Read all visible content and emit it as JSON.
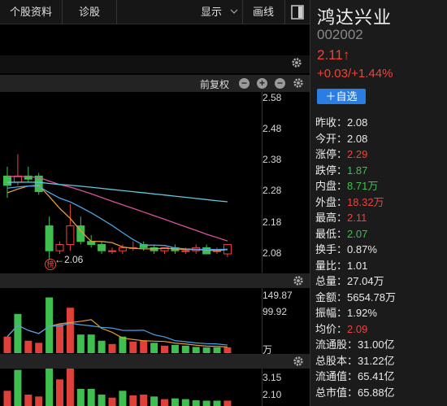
{
  "toolbar": {
    "profile_label": "个股资料",
    "diagnosis_label": "诊股",
    "display_label": "显示",
    "draw_label": "画线"
  },
  "kline_header": {
    "adjust_label": "前复权"
  },
  "price_axis": [
    "2.58",
    "2.48",
    "2.38",
    "2.28",
    "2.18",
    "2.08"
  ],
  "volume_axis": [
    "149.87",
    "99.92",
    "万"
  ],
  "indicator_axis": [
    "3.15",
    "2.10"
  ],
  "annotations": {
    "low_marker": "←2.06",
    "badge": "榜"
  },
  "chart_data": {
    "type": "candlestick",
    "ylim": [
      2.02,
      2.6
    ],
    "candles": [
      {
        "o": 2.33,
        "c": 2.3,
        "h": 2.36,
        "l": 2.26
      },
      {
        "o": 2.31,
        "c": 2.33,
        "h": 2.4,
        "l": 2.3
      },
      {
        "o": 2.33,
        "c": 2.32,
        "h": 2.36,
        "l": 2.31
      },
      {
        "o": 2.33,
        "c": 2.28,
        "h": 2.34,
        "l": 2.27
      },
      {
        "o": 2.17,
        "c": 2.09,
        "h": 2.2,
        "l": 2.06
      },
      {
        "o": 2.09,
        "c": 2.11,
        "h": 2.12,
        "l": 2.08
      },
      {
        "o": 2.11,
        "c": 2.17,
        "h": 2.24,
        "l": 2.09
      },
      {
        "o": 2.17,
        "c": 2.12,
        "h": 2.2,
        "l": 2.11
      },
      {
        "o": 2.12,
        "c": 2.11,
        "h": 2.14,
        "l": 2.1
      },
      {
        "o": 2.11,
        "c": 2.09,
        "h": 2.12,
        "l": 2.08
      },
      {
        "o": 2.09,
        "c": 2.09,
        "h": 2.1,
        "l": 2.08
      },
      {
        "o": 2.09,
        "c": 2.1,
        "h": 2.11,
        "l": 2.08
      },
      {
        "o": 2.1,
        "c": 2.1,
        "h": 2.12,
        "l": 2.09
      },
      {
        "o": 2.11,
        "c": 2.1,
        "h": 2.12,
        "l": 2.09
      },
      {
        "o": 2.1,
        "c": 2.09,
        "h": 2.11,
        "l": 2.08
      },
      {
        "o": 2.09,
        "c": 2.1,
        "h": 2.1,
        "l": 2.08
      },
      {
        "o": 2.1,
        "c": 2.09,
        "h": 2.11,
        "l": 2.08
      },
      {
        "o": 2.09,
        "c": 2.09,
        "h": 2.1,
        "l": 2.08
      },
      {
        "o": 2.09,
        "c": 2.1,
        "h": 2.11,
        "l": 2.08
      },
      {
        "o": 2.1,
        "c": 2.08,
        "h": 2.11,
        "l": 2.08
      },
      {
        "o": 2.09,
        "c": 2.09,
        "h": 2.1,
        "l": 2.08
      },
      {
        "o": 2.08,
        "c": 2.11,
        "h": 2.11,
        "l": 2.07
      }
    ],
    "volume": [
      {
        "v": 40,
        "up": true
      },
      {
        "v": 95,
        "up": false
      },
      {
        "v": 30,
        "up": true
      },
      {
        "v": 25,
        "up": true
      },
      {
        "v": 135,
        "up": false
      },
      {
        "v": 70,
        "up": true
      },
      {
        "v": 110,
        "up": true
      },
      {
        "v": 45,
        "up": false
      },
      {
        "v": 45,
        "up": false
      },
      {
        "v": 30,
        "up": false
      },
      {
        "v": 22,
        "up": true
      },
      {
        "v": 40,
        "up": false
      },
      {
        "v": 28,
        "up": true
      },
      {
        "v": 30,
        "up": true
      },
      {
        "v": 25,
        "up": false
      },
      {
        "v": 18,
        "up": true
      },
      {
        "v": 20,
        "up": false
      },
      {
        "v": 18,
        "up": false
      },
      {
        "v": 15,
        "up": false
      },
      {
        "v": 14,
        "up": false
      },
      {
        "v": 14,
        "up": false
      },
      {
        "v": 14,
        "up": true
      }
    ],
    "vol_max": 149.87,
    "ma_colors": {
      "ma5": "#e69a3c",
      "ma10": "#4aa3e6",
      "ma20": "#d94fa0",
      "ma60": "#5ec9e0"
    }
  },
  "quote": {
    "name": "鸿达兴业",
    "code": "002002",
    "price": "2.11↑",
    "change": "+0.03/+1.44%",
    "add_label": "＋自选"
  },
  "stats": [
    {
      "label": "昨收：",
      "value": "2.08",
      "color": "white"
    },
    {
      "label": "今开：",
      "value": "2.08",
      "color": "white"
    },
    {
      "label": "涨停：",
      "value": "2.29",
      "color": "red"
    },
    {
      "label": "跌停：",
      "value": "1.87",
      "color": "green"
    },
    {
      "label": "内盘：",
      "value": "8.71万",
      "color": "green"
    },
    {
      "label": "外盘：",
      "value": "18.32万",
      "color": "red"
    },
    {
      "label": "最高：",
      "value": "2.11",
      "color": "red"
    },
    {
      "label": "最低：",
      "value": "2.07",
      "color": "green"
    },
    {
      "label": "换手：",
      "value": "0.87%",
      "color": "white"
    },
    {
      "label": "量比：",
      "value": "1.01",
      "color": "white"
    },
    {
      "label": "总量：",
      "value": "27.04万",
      "color": "white"
    },
    {
      "label": "金额：",
      "value": "5654.78万",
      "color": "white"
    },
    {
      "label": "振幅：",
      "value": "1.92%",
      "color": "white"
    },
    {
      "label": "均价：",
      "value": "2.09",
      "color": "red"
    },
    {
      "label": "流通股：",
      "value": "31.00亿",
      "color": "white"
    },
    {
      "label": "总股本：",
      "value": "31.22亿",
      "color": "white"
    },
    {
      "label": "流通值：",
      "value": "65.41亿",
      "color": "white"
    },
    {
      "label": "总市值：",
      "value": "65.88亿",
      "color": "white"
    }
  ]
}
